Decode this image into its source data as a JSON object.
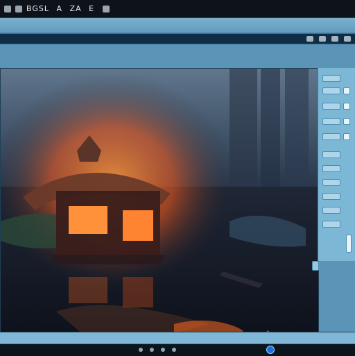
{
  "window": {
    "title_fragments": [
      "BGSL",
      "A",
      "ZA",
      "E"
    ]
  },
  "menubar": {
    "items": [
      "",
      "",
      "",
      "",
      "",
      ""
    ]
  },
  "toolbar": {
    "left_label": "",
    "right_label": ""
  },
  "sidepanel": {
    "controls_count": ""
  },
  "status": {
    "left": "",
    "right": ""
  },
  "icons": [
    "window-control-icon",
    "scroll-icon",
    "status-dot-icon",
    "scroll-right-icon"
  ],
  "colors": {
    "accent": "#1d6fe0",
    "panel": "#7cb7d6",
    "dark": "#0d1319"
  }
}
